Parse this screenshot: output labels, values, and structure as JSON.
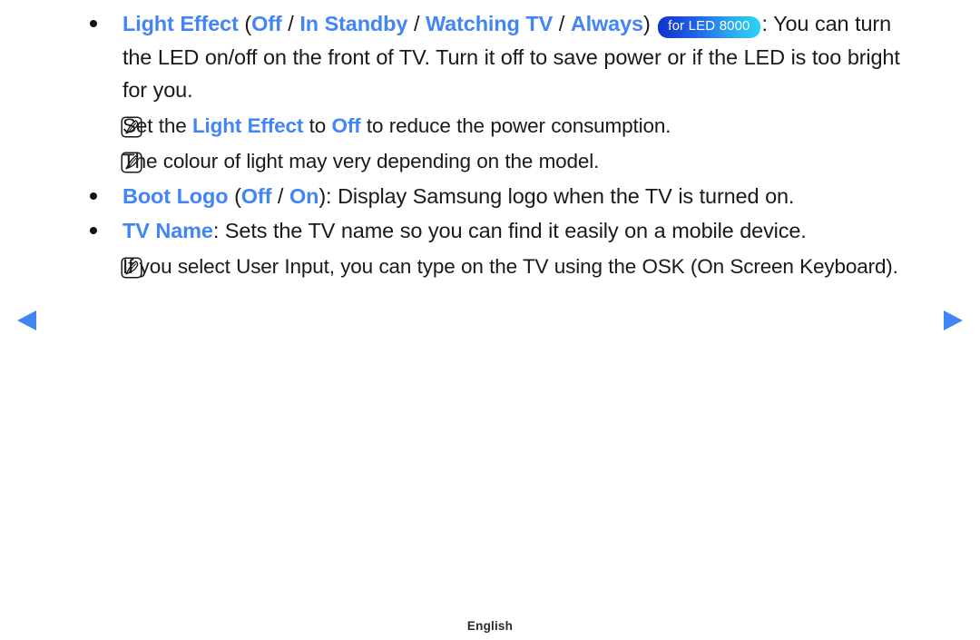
{
  "page": {
    "language_footer": "English",
    "accent_color": "#4285f4",
    "text_color": "#1a1a1a",
    "background_color": "#ffffff"
  },
  "nav": {
    "prev_icon": "triangle-left-icon",
    "next_icon": "triangle-right-icon",
    "arrow_color": "#4285f4"
  },
  "badge": {
    "label": "for LED 8000",
    "gradient_from": "#1033c8",
    "gradient_to": "#2ad6f7"
  },
  "items": [
    {
      "marker": "bullet",
      "name": "light-effect",
      "runs": [
        {
          "text": "Light Effect",
          "style": "em"
        },
        {
          "text": " (",
          "style": "plain"
        },
        {
          "text": "Off",
          "style": "em"
        },
        {
          "text": " / ",
          "style": "plain"
        },
        {
          "text": "In Standby",
          "style": "em"
        },
        {
          "text": " / ",
          "style": "plain"
        },
        {
          "text": "Watching TV",
          "style": "em"
        },
        {
          "text": " / ",
          "style": "plain"
        },
        {
          "text": "Always",
          "style": "em"
        },
        {
          "text": ") ",
          "style": "plain"
        },
        {
          "text": "for LED 8000",
          "style": "badge"
        },
        {
          "text": ": You can turn the LED on/off on the front of TV. Turn it off to save power or if the LED is too bright for you.",
          "style": "plain"
        }
      ]
    },
    {
      "marker": "note",
      "name": "note-light-effect-off",
      "runs": [
        {
          "text": "Set the ",
          "style": "plain"
        },
        {
          "text": "Light Effect",
          "style": "em"
        },
        {
          "text": " to ",
          "style": "plain"
        },
        {
          "text": "Off",
          "style": "em"
        },
        {
          "text": " to reduce the power consumption.",
          "style": "plain"
        }
      ]
    },
    {
      "marker": "note",
      "name": "note-colour-varies",
      "runs": [
        {
          "text": "The colour of light may very depending on the model.",
          "style": "plain"
        }
      ]
    },
    {
      "marker": "bullet",
      "name": "boot-logo",
      "runs": [
        {
          "text": "Boot Logo",
          "style": "em"
        },
        {
          "text": " (",
          "style": "plain"
        },
        {
          "text": "Off",
          "style": "em"
        },
        {
          "text": " / ",
          "style": "plain"
        },
        {
          "text": "On",
          "style": "em"
        },
        {
          "text": "): Display Samsung logo when the TV is turned on.",
          "style": "plain"
        }
      ]
    },
    {
      "marker": "bullet",
      "name": "tv-name",
      "runs": [
        {
          "text": "TV Name",
          "style": "em"
        },
        {
          "text": ": Sets the TV name so you can find it easily on a mobile device.",
          "style": "plain"
        }
      ]
    },
    {
      "marker": "note",
      "name": "note-user-input-osk",
      "runs": [
        {
          "text": "If you select User Input, you can type on the TV using the OSK (On Screen Keyboard).",
          "style": "plain"
        }
      ]
    }
  ]
}
